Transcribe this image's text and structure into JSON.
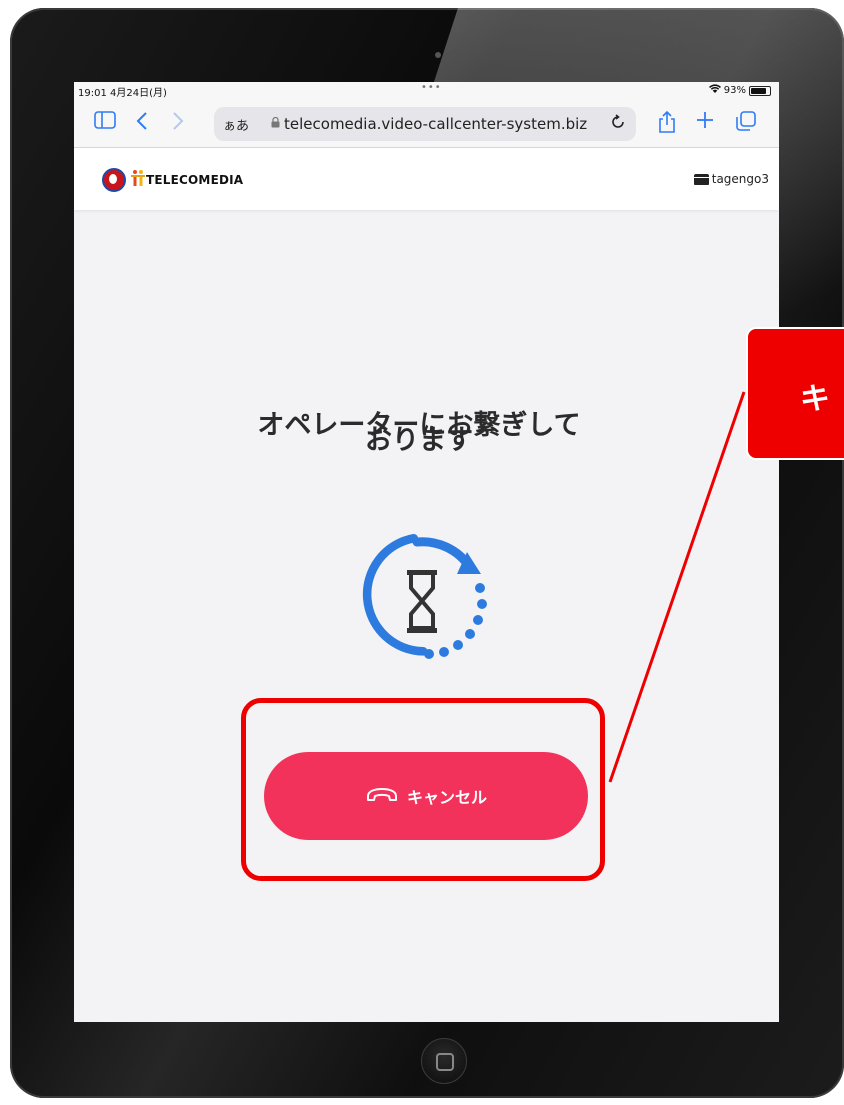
{
  "status_bar": {
    "time": "19:01  4月24日(月)",
    "dots": "•••",
    "battery_percent": "93%"
  },
  "browser": {
    "text_size_label": "ぁあ",
    "url": "telecomedia.video-callcenter-system.biz"
  },
  "site": {
    "logo_text": "TELECOMEDIA",
    "user_name": "tagengo3"
  },
  "main": {
    "heading_line1": "オペレーターにお繋ぎして",
    "heading_line2": "おります",
    "cancel_label": "キャンセル"
  },
  "annotation": {
    "callout_text": "キ"
  },
  "colors": {
    "accent": "#f2325a",
    "annotation_red": "#ee0000",
    "safari_blue": "#2f7cf6",
    "spinner_blue": "#2e7be0"
  }
}
